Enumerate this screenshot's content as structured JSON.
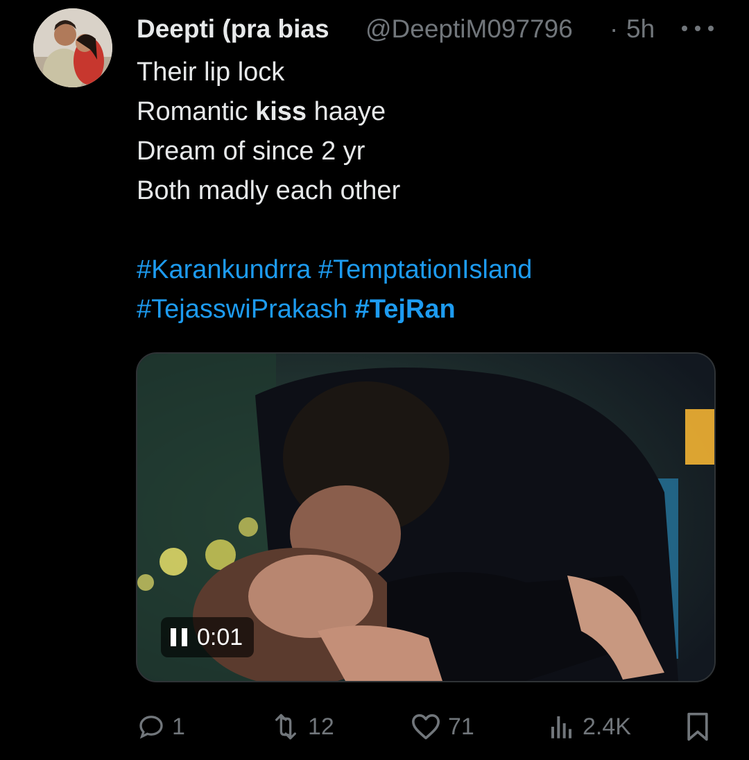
{
  "tweet": {
    "display_name": "Deepti (pra bias",
    "handle": "@DeeptiM097796",
    "separator": "·",
    "time": "5h",
    "more_icon": "more-horizontal-icon",
    "text_lines": [
      "Their lip lock",
      "Romantic",
      "kiss",
      "haaye",
      "Dream of since 2 yr",
      "Both madly each other"
    ],
    "hashtags_line1": [
      "#Karankundrra",
      "#TemptationIsland"
    ],
    "hashtags_line2": [
      "#TejasswiPrakash",
      "#TejRan"
    ]
  },
  "media": {
    "type": "video",
    "elapsed": "0:01",
    "pause_icon": "pause-icon"
  },
  "actions": {
    "reply": {
      "icon": "reply-icon",
      "count": "1"
    },
    "retweet": {
      "icon": "retweet-icon",
      "count": "12"
    },
    "like": {
      "icon": "heart-icon",
      "count": "71"
    },
    "views": {
      "icon": "analytics-icon",
      "count": "2.4K"
    },
    "bookmark": {
      "icon": "bookmark-icon"
    }
  },
  "colors": {
    "background": "#000000",
    "text": "#e7e9ea",
    "secondary": "#71767b",
    "link": "#1d9bf0"
  }
}
